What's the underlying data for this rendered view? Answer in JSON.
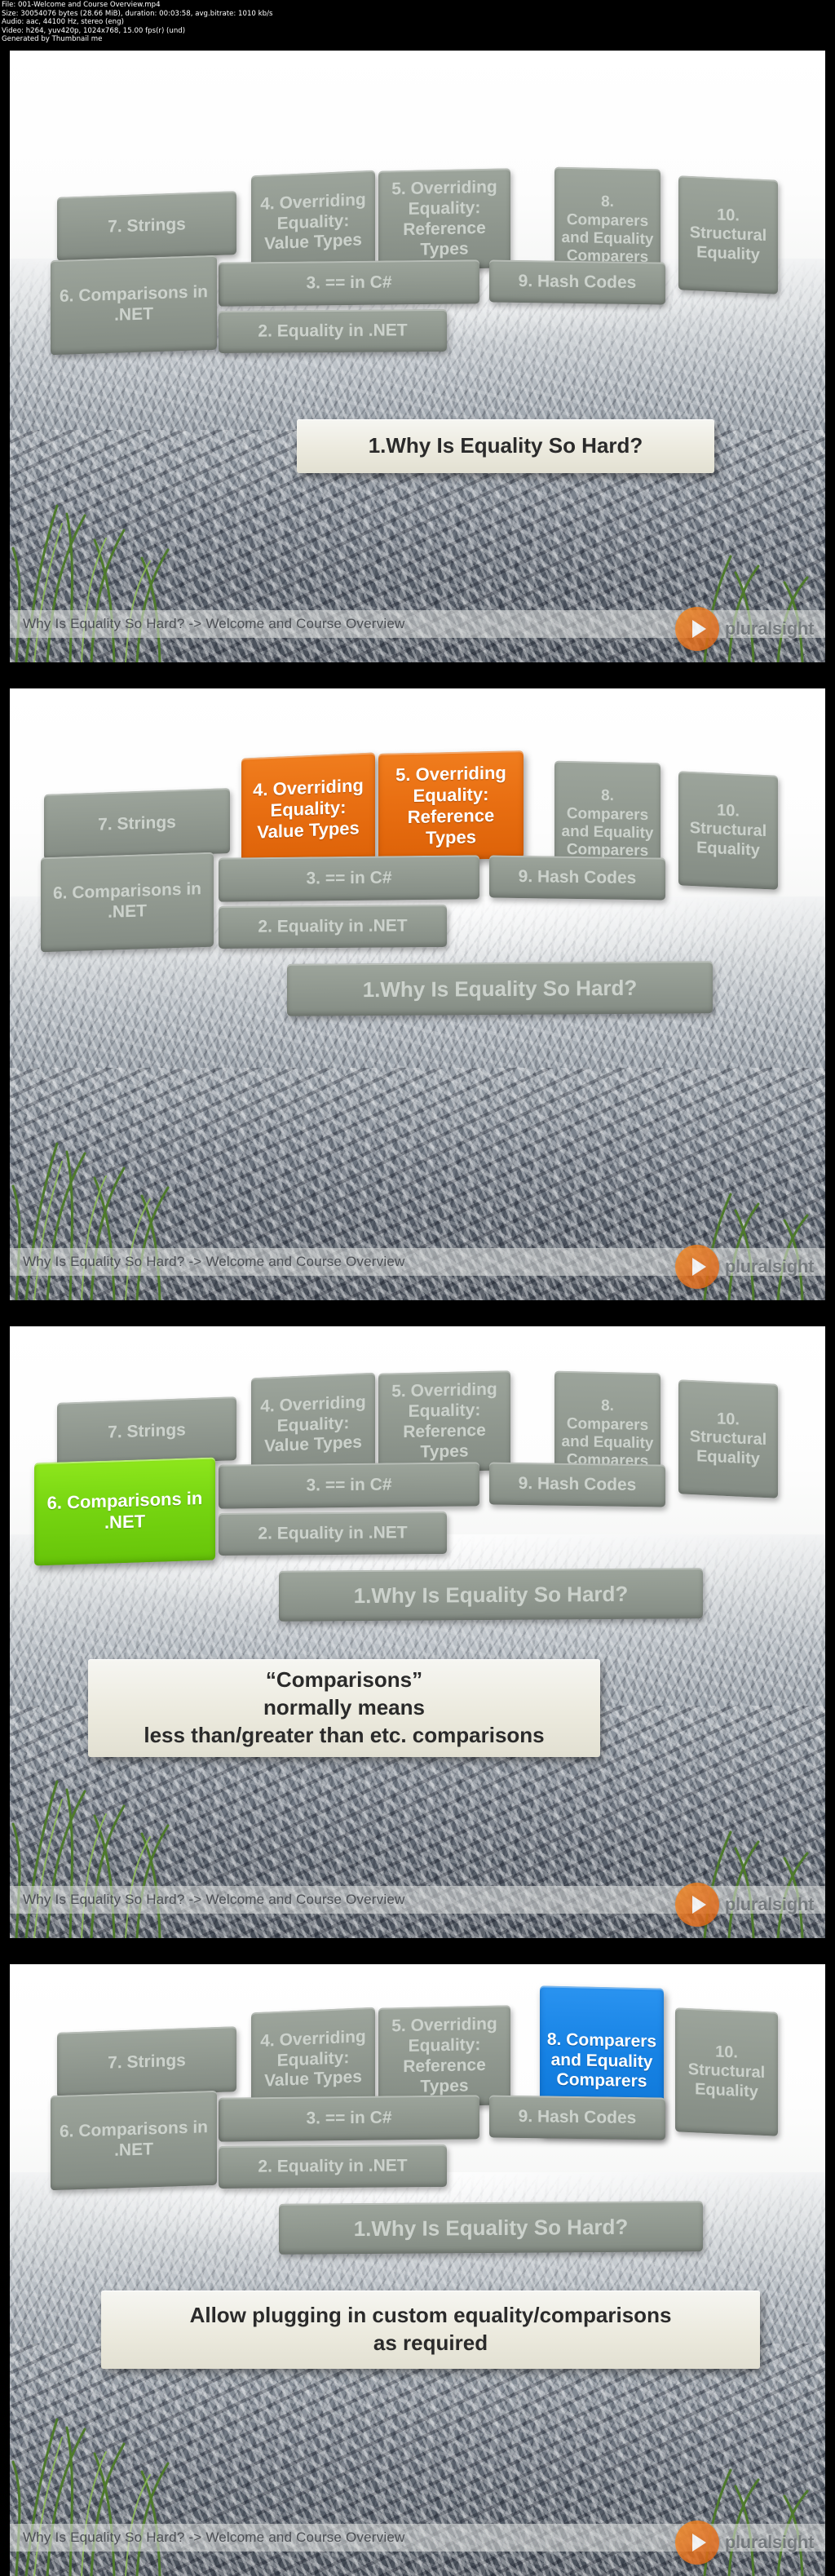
{
  "meta": {
    "lines": [
      "File: 001-Welcome and Course Overview.mp4",
      "Size: 30054076 bytes (28.66 MiB), duration: 00:03:58, avg.bitrate: 1010 kb/s",
      "Audio: aac, 44100 Hz, stereo (eng)",
      "Video: h264, yuv420p, 1024x768, 15.00 fps(r) (und)",
      "Generated by Thumbnail me"
    ],
    "file": "File: 001-Welcome and Course Overview.mp4",
    "size": "Size: 30054076 bytes (28.66 MiB), duration: 00:03:58, avg.bitrate: 1010 kb/s",
    "audio": "Audio: aac, 44100 Hz, stereo (eng)",
    "video": "Video: h264, yuv420p, 1024x768, 15.00 fps(r) (und)",
    "generator": "Generated by Thumbnail me"
  },
  "footer_text": "Why Is Equality So Hard? -> Welcome and Course Overview",
  "watermark": {
    "brand": "pluralsight",
    "play_icon": "play-triangle-icon"
  },
  "colors": {
    "brick_grey": "#8e968e",
    "highlight_orange": "#e96f12",
    "highlight_green": "#76d511",
    "highlight_blue": "#1682e4",
    "callout_bg": "#eceade",
    "brand_orange": "#e8701a"
  },
  "modules": {
    "m1": "1.Why Is Equality So Hard?",
    "m2": "2. Equality in .NET",
    "m3": "3. == in C#",
    "m4": "4. Overriding\nEquality:\nValue Types",
    "m5": "5. Overriding\nEquality:\nReference Types",
    "m6": "6.\nComparisons\nin .NET",
    "m7": "7. Strings",
    "m8": "8.\nComparers\nand\nEquality\nComparers",
    "m9": "9. Hash Codes",
    "m10": "10.\nStructural\nEquality"
  },
  "frames": [
    {
      "index": 1,
      "highlighted": [],
      "featured_module": "1.Why Is Equality So Hard?",
      "callout": null,
      "footer": "Why Is Equality So Hard? -> Welcome and Course Overview"
    },
    {
      "index": 2,
      "highlighted": [
        "4. Overriding Equality: Value Types",
        "5. Overriding Equality: Reference Types"
      ],
      "featured_module": null,
      "callout": null,
      "footer": "Why Is Equality So Hard? -> Welcome and Course Overview"
    },
    {
      "index": 3,
      "highlighted": [
        "6. Comparisons in .NET"
      ],
      "featured_module": null,
      "callout": "“Comparisons”\nnormally means\nless than/greater than etc. comparisons",
      "footer": "Why Is Equality So Hard? -> Welcome and Course Overview"
    },
    {
      "index": 4,
      "highlighted": [
        "8. Comparers and Equality Comparers"
      ],
      "featured_module": null,
      "callout": "Allow plugging in custom equality/comparisons\nas required",
      "footer": "Why Is Equality So Hard? -> Welcome and Course Overview"
    }
  ]
}
